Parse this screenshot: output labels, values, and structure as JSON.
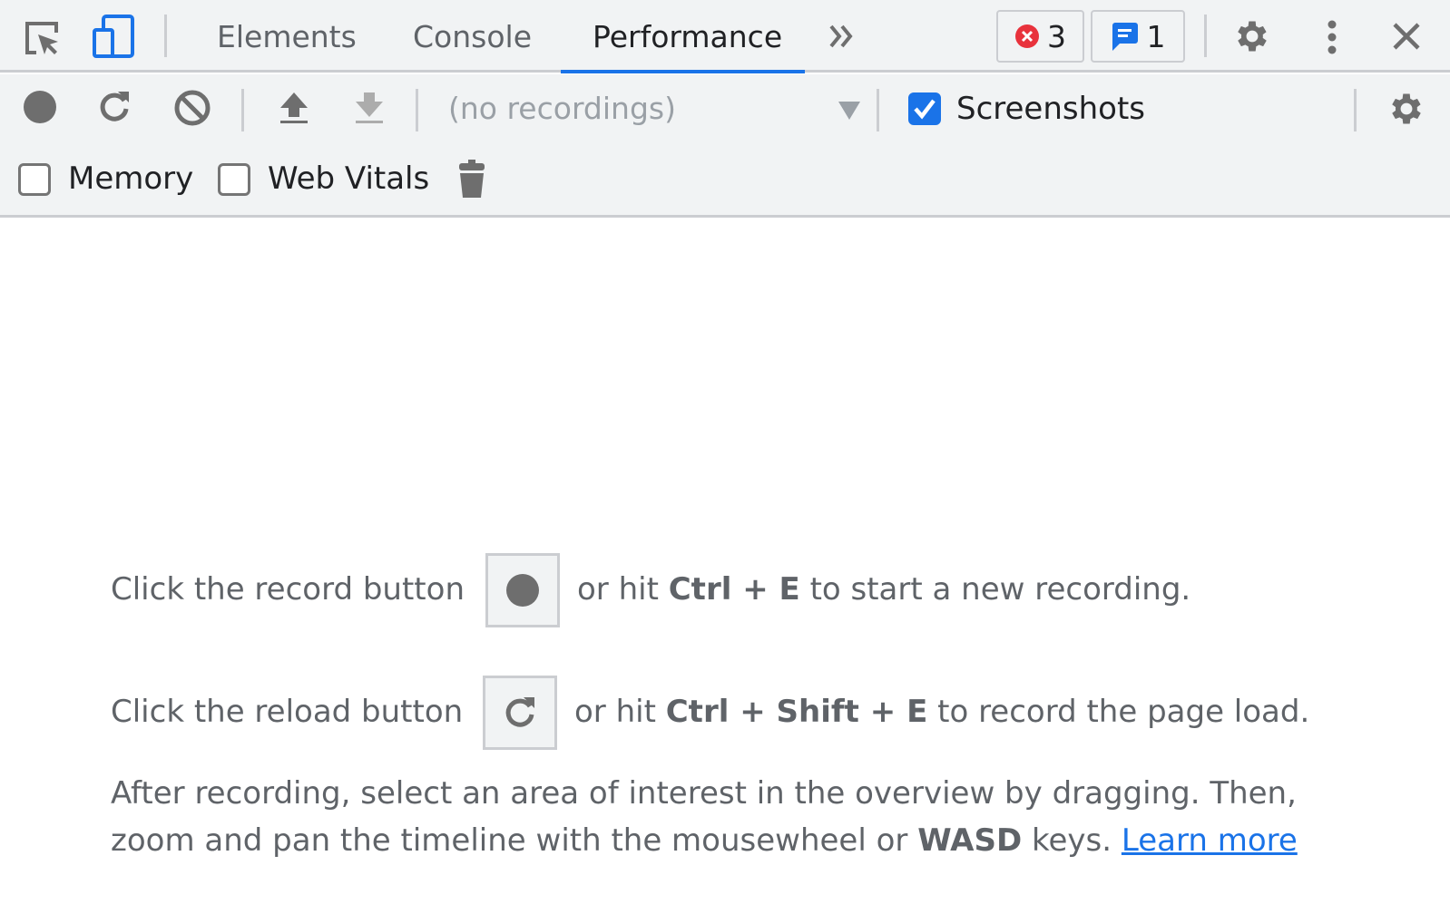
{
  "tabbar": {
    "inspect_icon": "inspect-element-icon",
    "device_icon": "device-toolbar-icon",
    "tabs": [
      {
        "label": "Elements",
        "active": false
      },
      {
        "label": "Console",
        "active": false
      },
      {
        "label": "Performance",
        "active": true
      }
    ],
    "more_tabs_icon": "double-chevron-right-icon",
    "errors_count": "3",
    "messages_count": "1",
    "settings_icon": "gear-icon",
    "menu_icon": "kebab-menu-icon",
    "close_icon": "close-icon"
  },
  "toolbar": {
    "record_icon": "record-icon",
    "reload_icon": "reload-icon",
    "clear_icon": "clear-icon",
    "upload_icon": "upload-icon",
    "download_icon": "download-icon",
    "recordings_select": "(no recordings)",
    "screenshots_label": "Screenshots",
    "screenshots_checked": true,
    "memory_label": "Memory",
    "memory_checked": false,
    "web_vitals_label": "Web Vitals",
    "web_vitals_checked": false,
    "garbage_icon": "trash-icon",
    "capture_settings_icon": "gear-icon"
  },
  "landing": {
    "record_line": {
      "before": "Click the record button",
      "or_hit": "or hit",
      "shortcut": "Ctrl + E",
      "after": "to start a new recording."
    },
    "reload_line": {
      "before": "Click the reload button",
      "or_hit": "or hit",
      "shortcut": "Ctrl + Shift + E",
      "after": "to record the page load."
    },
    "help_line1": "After recording, select an area of interest in the overview by dragging. Then,",
    "help_line2_before": "zoom and pan the timeline with the mousewheel or",
    "help_line2_keys": "WASD",
    "help_line2_after": "keys.",
    "learn_more": "Learn more"
  },
  "colors": {
    "accent": "#1a73e8",
    "error": "#e8323c",
    "icon": "#6e6e6e",
    "toolbar_bg": "#f1f3f4"
  }
}
